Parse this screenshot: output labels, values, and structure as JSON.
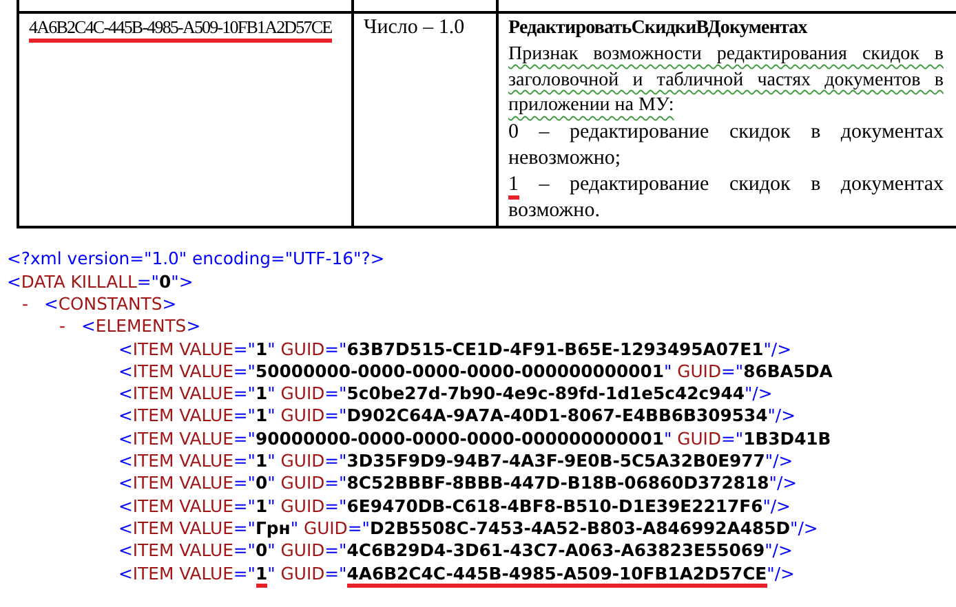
{
  "table": {
    "row": {
      "guid": {
        "text": "4A6B2C4C-445B-4985-A509-10FB1A2D57CE",
        "highlighted": true
      },
      "type": "Число – 1.0",
      "name": "РедактироватьСкидкиВДокументах",
      "description": {
        "text": "Признак возможности редактирования скидок в заголовочной и табличной частях документов в приложении на МУ:",
        "spellcheck_marked": true
      },
      "options": [
        {
          "value": "0",
          "text": "– редактирование скидок в документах невозможно;",
          "highlighted": false
        },
        {
          "value": "1",
          "text": "– редактирование скидок в документах возможно.",
          "highlighted": true
        }
      ]
    }
  },
  "xml": {
    "declaration": "<?xml version=\"1.0\" encoding=\"UTF-16\"?>",
    "root": {
      "segments": [
        {
          "punct": "<"
        },
        {
          "name": "DATA"
        },
        {
          "name": " KILLALL"
        },
        {
          "punct": "=\""
        },
        {
          "value": "0"
        },
        {
          "punct": "\">"
        }
      ],
      "children": [
        {
          "toggle": "-",
          "segments": [
            {
              "punct": "<"
            },
            {
              "name": "CONSTANTS"
            },
            {
              "punct": ">"
            }
          ],
          "children": [
            {
              "toggle": "-",
              "segments": [
                {
                  "punct": "<"
                },
                {
                  "name": "ELEMENTS"
                },
                {
                  "punct": ">"
                }
              ],
              "children": [
                {
                  "segments": [
                    {
                      "punct": "<"
                    },
                    {
                      "name": "ITEM VALUE"
                    },
                    {
                      "punct": "=\""
                    },
                    {
                      "value": "1"
                    },
                    {
                      "punct": "\""
                    },
                    {
                      "name": " GUID"
                    },
                    {
                      "punct": "=\""
                    },
                    {
                      "value": "63B7D515-CE1D-4F91-B65E-1293495A07E1"
                    },
                    {
                      "punct": "\"/>"
                    }
                  ]
                },
                {
                  "segments": [
                    {
                      "punct": "<"
                    },
                    {
                      "name": "ITEM VALUE"
                    },
                    {
                      "punct": "=\""
                    },
                    {
                      "value": "50000000-0000-0000-0000-000000000001"
                    },
                    {
                      "punct": "\""
                    },
                    {
                      "name": " GUID"
                    },
                    {
                      "punct": "=\""
                    },
                    {
                      "value": "86BA5DA"
                    }
                  ]
                },
                {
                  "segments": [
                    {
                      "punct": "<"
                    },
                    {
                      "name": "ITEM VALUE"
                    },
                    {
                      "punct": "=\""
                    },
                    {
                      "value": "1"
                    },
                    {
                      "punct": "\""
                    },
                    {
                      "name": " GUID"
                    },
                    {
                      "punct": "=\""
                    },
                    {
                      "value": "5c0be27d-7b90-4e9c-89fd-1d1e5c42c944"
                    },
                    {
                      "punct": "\"/>"
                    }
                  ]
                },
                {
                  "segments": [
                    {
                      "punct": "<"
                    },
                    {
                      "name": "ITEM VALUE"
                    },
                    {
                      "punct": "=\""
                    },
                    {
                      "value": "1"
                    },
                    {
                      "punct": "\""
                    },
                    {
                      "name": " GUID"
                    },
                    {
                      "punct": "=\""
                    },
                    {
                      "value": "D902C64A-9A7A-40D1-8067-E4BB6B309534"
                    },
                    {
                      "punct": "\"/>"
                    }
                  ]
                },
                {
                  "segments": [
                    {
                      "punct": "<"
                    },
                    {
                      "name": "ITEM VALUE"
                    },
                    {
                      "punct": "=\""
                    },
                    {
                      "value": "90000000-0000-0000-0000-000000000001"
                    },
                    {
                      "punct": "\""
                    },
                    {
                      "name": " GUID"
                    },
                    {
                      "punct": "=\""
                    },
                    {
                      "value": "1B3D41B"
                    }
                  ]
                },
                {
                  "segments": [
                    {
                      "punct": "<"
                    },
                    {
                      "name": "ITEM VALUE"
                    },
                    {
                      "punct": "=\""
                    },
                    {
                      "value": "1"
                    },
                    {
                      "punct": "\""
                    },
                    {
                      "name": " GUID"
                    },
                    {
                      "punct": "=\""
                    },
                    {
                      "value": "3D35F9D9-94B7-4A3F-9E0B-5C5A32B0E977"
                    },
                    {
                      "punct": "\"/>"
                    }
                  ]
                },
                {
                  "segments": [
                    {
                      "punct": "<"
                    },
                    {
                      "name": "ITEM VALUE"
                    },
                    {
                      "punct": "=\""
                    },
                    {
                      "value": "0"
                    },
                    {
                      "punct": "\""
                    },
                    {
                      "name": " GUID"
                    },
                    {
                      "punct": "=\""
                    },
                    {
                      "value": "8C52BBBF-8BBB-447D-B18B-06860D372818"
                    },
                    {
                      "punct": "\"/>"
                    }
                  ]
                },
                {
                  "segments": [
                    {
                      "punct": "<"
                    },
                    {
                      "name": "ITEM VALUE"
                    },
                    {
                      "punct": "=\""
                    },
                    {
                      "value": "1"
                    },
                    {
                      "punct": "\""
                    },
                    {
                      "name": " GUID"
                    },
                    {
                      "punct": "=\""
                    },
                    {
                      "value": "6E9470DB-C618-4BF8-B510-D1E39E2217F6"
                    },
                    {
                      "punct": "\"/>"
                    }
                  ]
                },
                {
                  "segments": [
                    {
                      "punct": "<"
                    },
                    {
                      "name": "ITEM VALUE"
                    },
                    {
                      "punct": "=\""
                    },
                    {
                      "value": "Грн"
                    },
                    {
                      "punct": "\""
                    },
                    {
                      "name": " GUID"
                    },
                    {
                      "punct": "=\""
                    },
                    {
                      "value": "D2B5508C-7453-4A52-B803-A846992A485D"
                    },
                    {
                      "punct": "\"/>"
                    }
                  ]
                },
                {
                  "segments": [
                    {
                      "punct": "<"
                    },
                    {
                      "name": "ITEM VALUE"
                    },
                    {
                      "punct": "=\""
                    },
                    {
                      "value": "0"
                    },
                    {
                      "punct": "\""
                    },
                    {
                      "name": " GUID"
                    },
                    {
                      "punct": "=\""
                    },
                    {
                      "value": "4C6B29D4-3D61-43C7-A063-A63823E55069"
                    },
                    {
                      "punct": "\"/>"
                    }
                  ]
                },
                {
                  "segments": [
                    {
                      "punct": "<"
                    },
                    {
                      "name": "ITEM VALUE"
                    },
                    {
                      "punct": "=\""
                    },
                    {
                      "value": "1",
                      "highlighted": true
                    },
                    {
                      "punct": "\""
                    },
                    {
                      "name": " GUID"
                    },
                    {
                      "punct": "=\""
                    },
                    {
                      "value": "4A6B2C4C-445B-4985-A509-10FB1A2D57CE",
                      "highlighted": true
                    },
                    {
                      "punct": "\"/>"
                    }
                  ]
                }
              ]
            }
          ]
        }
      ]
    }
  }
}
